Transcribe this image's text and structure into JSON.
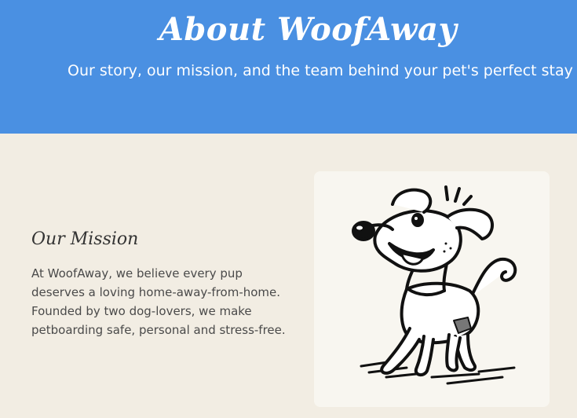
{
  "hero": {
    "title": "About WoofAway",
    "subtitle": "Our story, our mission, and the team behind your pet's perfect stay",
    "background_color": "#4a90e2"
  },
  "mission": {
    "heading": "Our Mission",
    "text": "At WoofAway, we believe every pup deserves a loving home-away-from-home. Founded by two dog-lovers, we make petboarding safe, personal and stress-free."
  },
  "illustration": {
    "icon": "cartoon-dog-illustration"
  },
  "colors": {
    "page_background": "#f2ede3",
    "card_background": "#f8f6f0",
    "text": "#4a4a4a"
  }
}
